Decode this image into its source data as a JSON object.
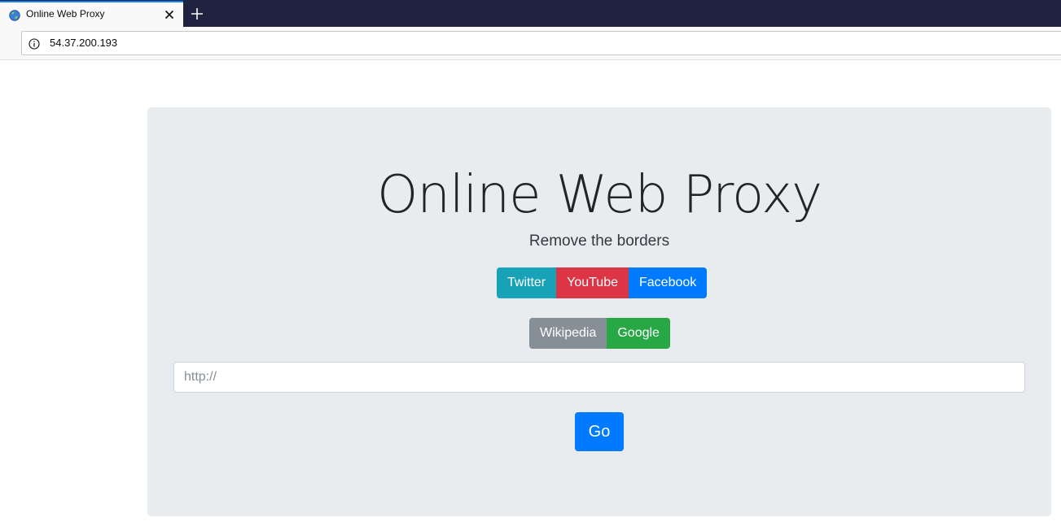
{
  "browser": {
    "tab_title": "Online Web Proxy",
    "url": "54.37.200.193",
    "icons": {
      "favicon": "globe-icon",
      "close": "close-icon",
      "new_tab": "plus-icon",
      "site_info": "info-icon"
    }
  },
  "page": {
    "title": "Online Web Proxy",
    "subtitle": "Remove the borders",
    "quick_links_row1": [
      {
        "label": "Twitter",
        "color": "#17a2b8"
      },
      {
        "label": "YouTube",
        "color": "#dc3545"
      },
      {
        "label": "Facebook",
        "color": "#007bff"
      }
    ],
    "quick_links_row2": [
      {
        "label": "Wikipedia",
        "color": "#868e96"
      },
      {
        "label": "Google",
        "color": "#28a745"
      }
    ],
    "url_input": {
      "placeholder": "http://",
      "value": ""
    },
    "go_label": "Go"
  },
  "colors": {
    "tabstrip": "#202340",
    "jumbotron_bg": "#e9ecef",
    "primary": "#007bff"
  }
}
